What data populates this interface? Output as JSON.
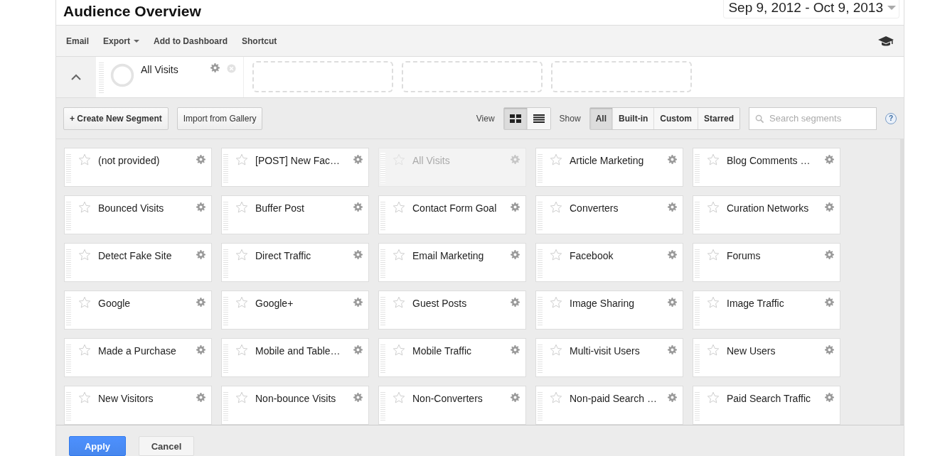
{
  "header": {
    "title": "Audience Overview",
    "date_range": "Sep 9, 2012 - Oct 9, 2013"
  },
  "toolbar": {
    "items": [
      {
        "label": "Email",
        "kind": "link"
      },
      {
        "label": "Export",
        "kind": "dropdown"
      },
      {
        "label": "Add to Dashboard",
        "kind": "link"
      },
      {
        "label": "Shortcut",
        "kind": "link"
      }
    ]
  },
  "applied_segments": [
    {
      "name": "All Visits"
    }
  ],
  "actions": {
    "create": "+ Create New Segment",
    "import": "Import from Gallery"
  },
  "view": {
    "label": "View",
    "options": [
      {
        "kind": "grid",
        "selected": true
      },
      {
        "kind": "list",
        "selected": false
      }
    ]
  },
  "show": {
    "label": "Show",
    "options": [
      {
        "label": "All",
        "selected": true
      },
      {
        "label": "Built-in",
        "selected": false
      },
      {
        "label": "Custom",
        "selected": false
      },
      {
        "label": "Starred",
        "selected": false
      }
    ]
  },
  "search": {
    "placeholder": "Search segments"
  },
  "help": "?",
  "segments": [
    {
      "name": "(not provided)",
      "starred": false,
      "disabled": false
    },
    {
      "name": "[POST] New Fac…",
      "starred": false,
      "disabled": false
    },
    {
      "name": "All Visits",
      "starred": false,
      "disabled": true
    },
    {
      "name": "Article Marketing",
      "starred": false,
      "disabled": false
    },
    {
      "name": "Blog Comments …",
      "starred": false,
      "disabled": false
    },
    {
      "name": "Bounced Visits",
      "starred": false,
      "disabled": false
    },
    {
      "name": "Buffer Post",
      "starred": false,
      "disabled": false
    },
    {
      "name": "Contact Form Goal",
      "starred": false,
      "disabled": false
    },
    {
      "name": "Converters",
      "starred": false,
      "disabled": false
    },
    {
      "name": "Curation Networks",
      "starred": false,
      "disabled": false
    },
    {
      "name": "Detect Fake Site",
      "starred": false,
      "disabled": false
    },
    {
      "name": "Direct Traffic",
      "starred": false,
      "disabled": false
    },
    {
      "name": "Email Marketing",
      "starred": false,
      "disabled": false
    },
    {
      "name": "Facebook",
      "starred": false,
      "disabled": false
    },
    {
      "name": "Forums",
      "starred": false,
      "disabled": false
    },
    {
      "name": "Google",
      "starred": false,
      "disabled": false
    },
    {
      "name": "Google+",
      "starred": false,
      "disabled": false
    },
    {
      "name": "Guest Posts",
      "starred": false,
      "disabled": false
    },
    {
      "name": "Image Sharing",
      "starred": false,
      "disabled": false
    },
    {
      "name": "Image Traffic",
      "starred": false,
      "disabled": false
    },
    {
      "name": "Made a Purchase",
      "starred": false,
      "disabled": false
    },
    {
      "name": "Mobile and Table…",
      "starred": false,
      "disabled": false
    },
    {
      "name": "Mobile Traffic",
      "starred": false,
      "disabled": false
    },
    {
      "name": "Multi-visit Users",
      "starred": false,
      "disabled": false
    },
    {
      "name": "New Users",
      "starred": false,
      "disabled": false
    },
    {
      "name": "New Visitors",
      "starred": false,
      "disabled": false
    },
    {
      "name": "Non-bounce Visits",
      "starred": false,
      "disabled": false
    },
    {
      "name": "Non-Converters",
      "starred": false,
      "disabled": false
    },
    {
      "name": "Non-paid Search …",
      "starred": false,
      "disabled": false
    },
    {
      "name": "Paid Search Traffic",
      "starred": false,
      "disabled": false
    }
  ],
  "footer": {
    "apply": "Apply",
    "cancel": "Cancel"
  }
}
